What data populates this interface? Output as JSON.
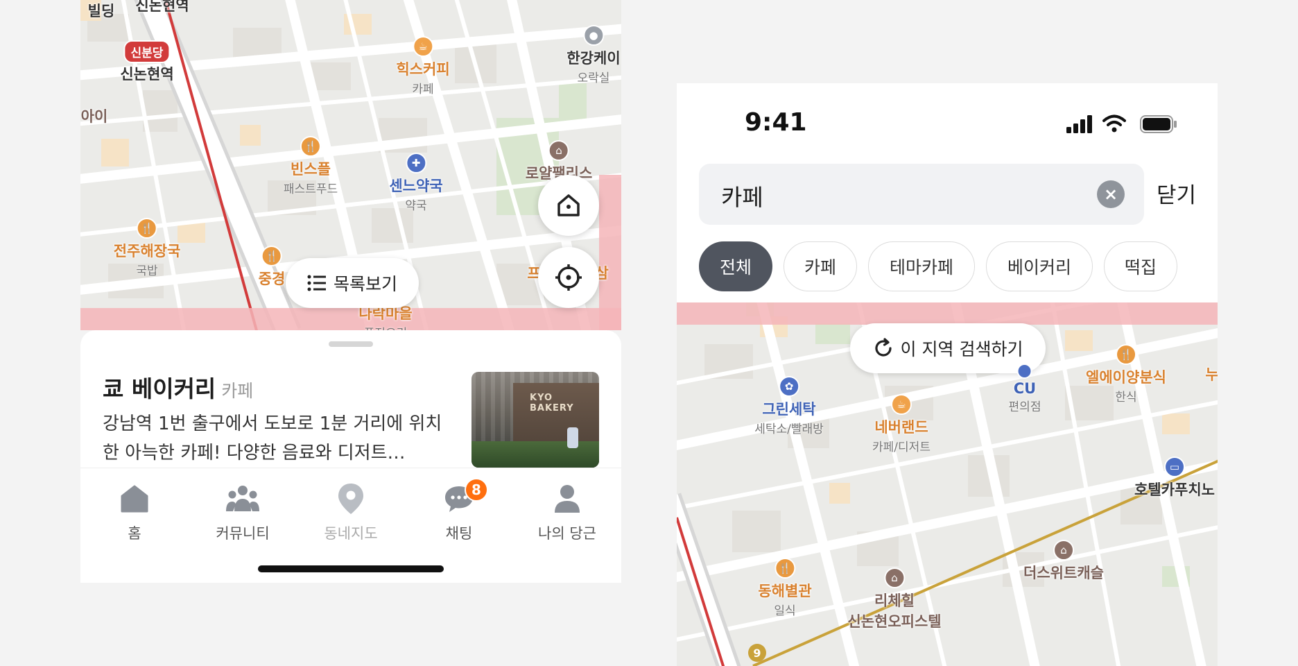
{
  "left_panel": {
    "map_labels": [
      {
        "name": "빌딩",
        "category": "",
        "style": "dark"
      },
      {
        "name": "신논현역",
        "category": "",
        "style": "dark"
      },
      {
        "name": "신분당",
        "category": "",
        "style": "line-badge"
      },
      {
        "name": "신논현역",
        "category": "",
        "style": "dark"
      },
      {
        "name": "아이",
        "category": "",
        "style": "brown"
      },
      {
        "name": "힉스커피",
        "category": "카페",
        "style": "cafe"
      },
      {
        "name": "한강케이",
        "category": "오락실",
        "style": "dark"
      },
      {
        "name": "빈스플",
        "category": "패스트푸드",
        "style": "food"
      },
      {
        "name": "센느약국",
        "category": "약국",
        "style": "blue"
      },
      {
        "name": "로얄팰리스",
        "category": "",
        "style": "brown"
      },
      {
        "name": "전주해장국",
        "category": "국밥",
        "style": "food"
      },
      {
        "name": "중경",
        "category": "",
        "style": "food"
      },
      {
        "name": "나락마을",
        "category": "퓨전요리",
        "style": "food"
      },
      {
        "name": "프",
        "category": "",
        "style": "food"
      },
      {
        "name": "삼",
        "category": "",
        "style": "food"
      }
    ],
    "list_view_button": "목록보기",
    "store": {
      "name": "쿄 베이커리",
      "category": "카페",
      "description": "강남역 1번 출구에서 도보로 1분 거리에 위치한 아늑한 카페! 다양한 음료와 디저트…",
      "thumb_sign": "KYO BAKERY"
    },
    "tabs": [
      {
        "label": "홈",
        "icon": "home-icon",
        "badge": ""
      },
      {
        "label": "커뮤니티",
        "icon": "community-icon",
        "badge": ""
      },
      {
        "label": "동네지도",
        "icon": "map-pin-icon",
        "badge": ""
      },
      {
        "label": "채팅",
        "icon": "chat-icon",
        "badge": "8"
      },
      {
        "label": "나의 당근",
        "icon": "profile-icon",
        "badge": ""
      }
    ]
  },
  "right_panel": {
    "status_time": "9:41",
    "search": {
      "value": "카페"
    },
    "close_label": "닫기",
    "chips": [
      {
        "label": "전체",
        "active": true
      },
      {
        "label": "카페",
        "active": false
      },
      {
        "label": "테마카페",
        "active": false
      },
      {
        "label": "베이커리",
        "active": false
      },
      {
        "label": "떡집",
        "active": false
      }
    ],
    "area_search_button": "이 지역 검색하기",
    "map_labels": [
      {
        "name": "그린세탁",
        "category": "세탁소/빨래방",
        "style": "blue"
      },
      {
        "name": "CU",
        "category": "편의점",
        "style": "blue"
      },
      {
        "name": "엘에이양분식",
        "category": "한식",
        "style": "food"
      },
      {
        "name": "누",
        "category": "",
        "style": "food"
      },
      {
        "name": "네버랜드",
        "category": "카페/디저트",
        "style": "cafe"
      },
      {
        "name": "호텔카푸치노",
        "category": "",
        "style": "dark"
      },
      {
        "name": "더스위트캐슬",
        "category": "",
        "style": "brown"
      },
      {
        "name": "동해별관",
        "category": "일식",
        "style": "food"
      },
      {
        "name": "리체힐",
        "category": "신논현오피스텔",
        "style": "brown"
      },
      {
        "name": "9",
        "category": "",
        "style": "line-badge"
      }
    ]
  },
  "colors": {
    "brand_orange": "#ff6f0f",
    "chip_active": "#50555f",
    "subway_red": "#d23b3b",
    "subway_gold": "#c9a23a"
  }
}
